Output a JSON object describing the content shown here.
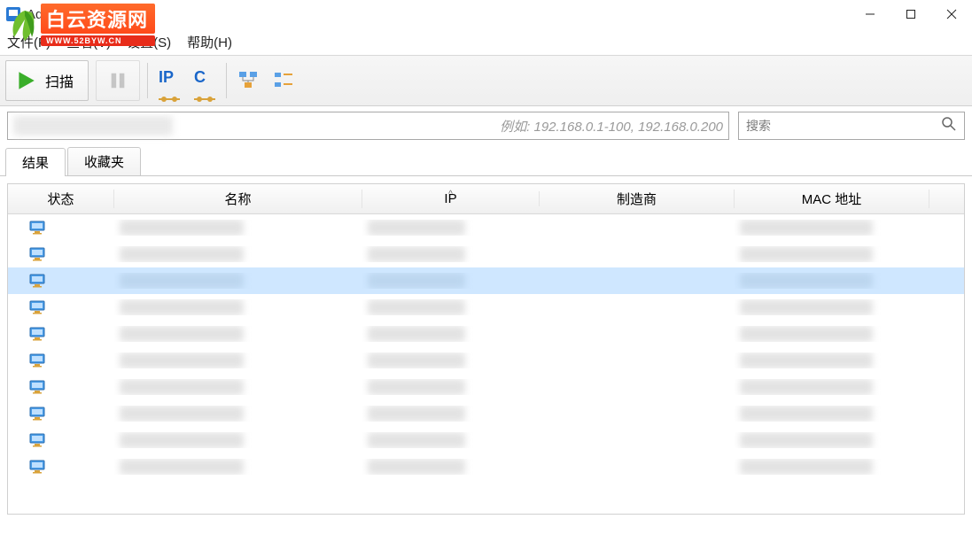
{
  "window": {
    "title": "Advanced IP Scanner"
  },
  "watermark": {
    "main": "白云资源网",
    "sub": "WWW.52BYW.CN"
  },
  "menu": {
    "file": "文件(F)",
    "view": "查看(V)",
    "settings": "设置(S)",
    "help": "帮助(H)"
  },
  "toolbar": {
    "scan": "扫描",
    "ip_icon": "IP",
    "c_icon": "C"
  },
  "inputs": {
    "ip_placeholder": "例如:  192.168.0.1-100, 192.168.0.200",
    "search_placeholder": "搜索"
  },
  "tabs": {
    "results": "结果",
    "favorites": "收藏夹"
  },
  "columns": {
    "status": "状态",
    "name": "名称",
    "ip": "IP",
    "manufacturer": "制造商",
    "mac": "MAC 地址"
  },
  "rows": [
    {
      "selected": false,
      "has_mfr": false
    },
    {
      "selected": false,
      "has_mfr": false
    },
    {
      "selected": true,
      "has_mfr": false
    },
    {
      "selected": false,
      "has_mfr": false
    },
    {
      "selected": false,
      "has_mfr": false
    },
    {
      "selected": false,
      "has_mfr": false
    },
    {
      "selected": false,
      "has_mfr": false
    },
    {
      "selected": false,
      "has_mfr": false
    },
    {
      "selected": false,
      "has_mfr": false
    },
    {
      "selected": false,
      "has_mfr": false
    }
  ]
}
